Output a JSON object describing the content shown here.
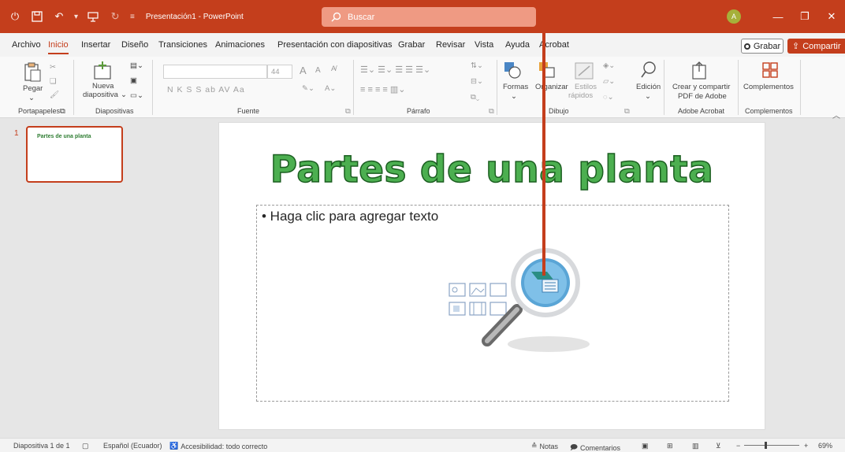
{
  "titlebar": {
    "app_title": "Presentación1 - PowerPoint",
    "search_placeholder": "Buscar",
    "avatar_initial": "A",
    "accent_color": "#c43e1c"
  },
  "menu": {
    "tabs": [
      "Archivo",
      "Inicio",
      "Insertar",
      "Diseño",
      "Transiciones",
      "Animaciones",
      "Presentación con diapositivas",
      "Grabar",
      "Revisar",
      "Vista",
      "Ayuda",
      "Acrobat"
    ],
    "active_tab": "Inicio",
    "record_label": "Grabar",
    "share_label": "Compartir"
  },
  "ribbon": {
    "groups": {
      "clipboard": "Portapapeles",
      "slides": "Diapositivas",
      "font": "Fuente",
      "paragraph": "Párrafo",
      "drawing": "Dibujo",
      "acrobat": "Adobe Acrobat",
      "addins": "Complementos"
    },
    "buttons": {
      "paste": "Pegar",
      "new_slide_line1": "Nueva",
      "new_slide_line2": "diapositiva",
      "font_size": "44",
      "shapes": "Formas",
      "arrange": "Organizar",
      "quick_styles_line1": "Estilos",
      "quick_styles_line2": "rápidos",
      "editing": "Edición",
      "create_pdf_line1": "Crear y compartir",
      "create_pdf_line2": "PDF de Adobe",
      "addins": "Complementos",
      "bold_row": "N  K  S  S  ab  AV  Aa",
      "font_grow": "A",
      "font_shrink": "A"
    }
  },
  "thumbnails": [
    {
      "number": "1",
      "title": "Partes de una planta"
    }
  ],
  "slide": {
    "title": "Partes de una planta",
    "placeholder": "• Haga clic para agregar texto",
    "title_color": "#4caf50"
  },
  "statusbar": {
    "slide_info": "Diapositiva 1 de 1",
    "language": "Español (Ecuador)",
    "accessibility": "Accesibilidad: todo correcto",
    "notes": "Notas",
    "comments": "Comentarios",
    "zoom": "69%"
  }
}
